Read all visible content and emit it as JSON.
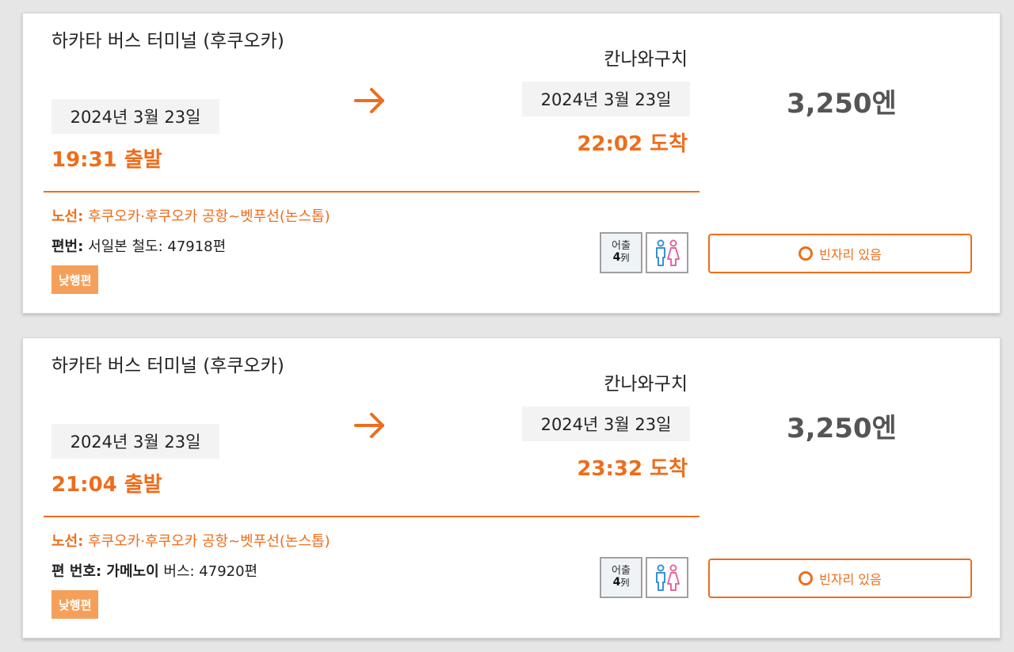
{
  "results": [
    {
      "origin": "하카타 버스 터미널 (후쿠오카)",
      "departure_date": "2024년 3월 23일",
      "departure_time": "19:31 출발",
      "destination": "칸나와구치",
      "arrival_date": "2024년 3월 23일",
      "arrival_time": "22:02 도착",
      "price": "3,250엔",
      "route_label": "노선:",
      "route": "후쿠오카·후쿠오카 공항~벳푸선(논스톱)",
      "flight_label": "편번:",
      "flight": "서일본 철도: 47918편",
      "badge": "낮행편",
      "seat_top": "어출",
      "seat_num": "4",
      "seat_unit": "列",
      "availability": "빈자리 있음"
    },
    {
      "origin": "하카타 버스 터미널 (후쿠오카)",
      "departure_date": "2024년 3월 23일",
      "departure_time": "21:04 출발",
      "destination": "칸나와구치",
      "arrival_date": "2024년 3월 23일",
      "arrival_time": "23:32 도착",
      "price": "3,250엔",
      "route_label": "노선:",
      "route": "후쿠오카·후쿠오카 공항~벳푸선(논스톱)",
      "flight_label": "편 번호: 가메노이",
      "flight": "버스: 47920편",
      "badge": "낮행편",
      "seat_top": "어출",
      "seat_num": "4",
      "seat_unit": "列",
      "availability": "빈자리 있음"
    }
  ],
  "colors": {
    "accent": "#ee6d1b",
    "badge": "#f5a05a",
    "price": "#555555",
    "date_bg": "#f3f3f3"
  },
  "icons": {
    "arrow": "arrow-right-icon",
    "restroom": "restroom-icon",
    "seats": "seat-rows-icon",
    "availability": "circle-icon"
  }
}
